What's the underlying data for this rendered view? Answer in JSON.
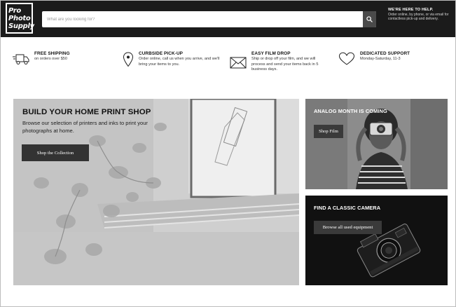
{
  "header": {
    "logo": [
      "Pro",
      "Photo",
      "Supply"
    ],
    "search_placeholder": "What are you looking for?",
    "search_button_icon": "search-icon",
    "help_title": "WE'RE HERE TO HELP.",
    "help_text": "Order online, by phone, or via email for contactless pick-up and delivery."
  },
  "features": [
    {
      "icon": "truck-icon",
      "title": "FREE SHIPPING",
      "text": "on orders over $50"
    },
    {
      "icon": "map-pin-icon",
      "title": "CURBSIDE PICK-UP",
      "text": "Order online, call us when you arrive, and we'll bring your items to you."
    },
    {
      "icon": "mail-icon",
      "title": "EASY FILM DROP",
      "text": "Ship or drop off your film, and we will process and send your items back in 5 business days."
    },
    {
      "icon": "heart-icon",
      "title": "DEDICATED SUPPORT",
      "text": "Monday-Saturday, 11-3"
    }
  ],
  "hero": {
    "title": "BUILD YOUR HOME PRINT SHOP",
    "subtitle": "Browse our selection of printers and inks to print your photographs at home.",
    "button": "Shop the Collection"
  },
  "panels": [
    {
      "title": "ANALOG MONTH IS COMING",
      "button": "Shop Film"
    },
    {
      "title": "FIND A CLASSIC CAMERA",
      "button": "Browse all used equipment"
    }
  ],
  "colors": {
    "header_bg": "#1b1b1b",
    "button_bg": "#333333",
    "text": "#222222"
  }
}
